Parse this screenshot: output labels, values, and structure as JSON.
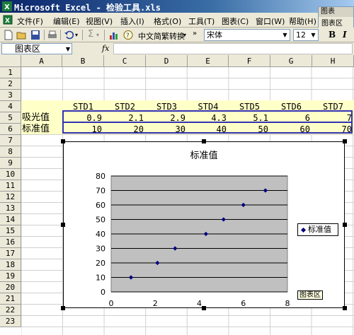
{
  "window": {
    "title": "Microsoft Excel - 检验工具.xls"
  },
  "menu": {
    "items": [
      "文件(F)",
      "编辑(E)",
      "视图(V)",
      "插入(I)",
      "格式(O)",
      "工具(T)",
      "图表(C)",
      "窗口(W)",
      "帮助(H)"
    ]
  },
  "chart_toolbar": {
    "title": "图表",
    "field": "图表区"
  },
  "toolbar": {
    "translate_label": "中文简繁转换",
    "font_name": "宋体",
    "font_size": "12",
    "bold_label": "B",
    "italic_label": "I"
  },
  "formula_bar": {
    "name_box": "图表区",
    "fx_label": "fx",
    "formula": ""
  },
  "columns": [
    "A",
    "B",
    "C",
    "D",
    "E",
    "F",
    "G",
    "H"
  ],
  "rows": [
    "1",
    "2",
    "3",
    "4",
    "5",
    "6",
    "7",
    "8",
    "9",
    "10",
    "11",
    "12",
    "13",
    "14",
    "15",
    "16",
    "17",
    "18",
    "19",
    "20",
    "21",
    "22",
    "23"
  ],
  "table": {
    "headers": [
      "STD1",
      "STD2",
      "STD3",
      "STD4",
      "STD5",
      "STD6",
      "STD7"
    ],
    "absorbance_label": "吸光值",
    "absorbance": [
      "0.9",
      "2.1",
      "2.9",
      "4.3",
      "5.1",
      "6",
      "7"
    ],
    "standard_label": "标准值",
    "standard": [
      "10",
      "20",
      "30",
      "40",
      "50",
      "60",
      "70"
    ]
  },
  "chart_tooltip": "图表区",
  "chart_data": {
    "type": "scatter",
    "title": "标准值",
    "xlabel": "",
    "ylabel": "",
    "xlim": [
      0,
      8
    ],
    "ylim": [
      0,
      80
    ],
    "x_ticks": [
      "0",
      "2",
      "4",
      "6",
      "8"
    ],
    "y_ticks": [
      "0",
      "10",
      "20",
      "30",
      "40",
      "50",
      "60",
      "70",
      "80"
    ],
    "grid": "horizontal",
    "plot_background": "#c0c0c0",
    "marker_color": "#000080",
    "legend_position": "right",
    "series": [
      {
        "name": "标准值",
        "x": [
          0.9,
          2.1,
          2.9,
          4.3,
          5.1,
          6,
          7
        ],
        "y": [
          10,
          20,
          30,
          40,
          50,
          60,
          70
        ]
      }
    ]
  }
}
